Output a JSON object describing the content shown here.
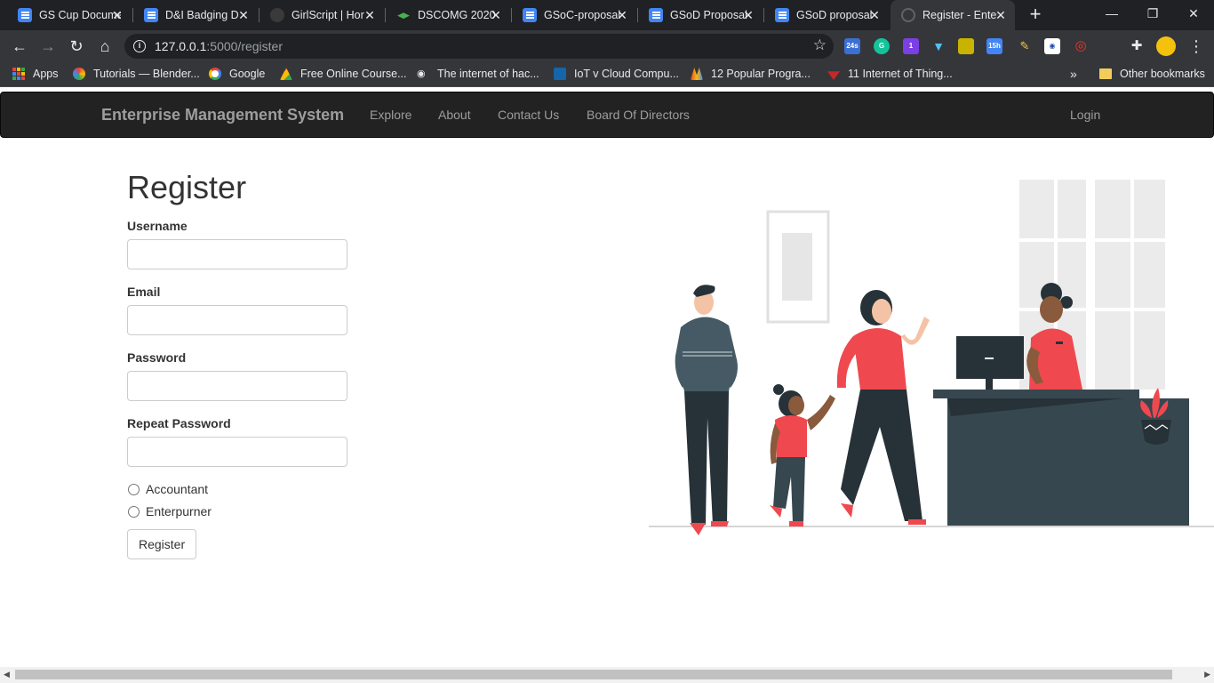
{
  "browser": {
    "tabs": [
      {
        "title": "GS Cup Documen",
        "icon": "docs-icon"
      },
      {
        "title": "D&I Badging D",
        "icon": "docs-icon"
      },
      {
        "title": "GirlScript | Hor",
        "icon": "girlscript-icon"
      },
      {
        "title": "DSCOMG 2020",
        "icon": "dsc-icon"
      },
      {
        "title": "GSoC-proposal",
        "icon": "docs-icon"
      },
      {
        "title": "GSoD Proposal",
        "icon": "docs-icon"
      },
      {
        "title": "GSoD proposal",
        "icon": "docs-icon"
      },
      {
        "title": "Register - Ente",
        "icon": "globe-icon",
        "active": true
      }
    ],
    "url_host": "127.0.0.1",
    "url_path": ":5000/register",
    "bookmarks": [
      "Apps",
      "Tutorials — Blender...",
      "Google",
      "Free Online Course...",
      "The internet of hac...",
      "IoT v Cloud Compu...",
      "12 Popular Progra...",
      "11 Internet of Thing..."
    ],
    "bookmarks_more": "»",
    "other_bookmarks": "Other bookmarks",
    "extensions": {
      "badge_1": "24s",
      "badge_2": "1",
      "badge_3": "15h"
    }
  },
  "navbar": {
    "brand": "Enterprise Management System",
    "links": [
      "Explore",
      "About",
      "Contact Us",
      "Board Of Directors"
    ],
    "login": "Login"
  },
  "form": {
    "title": "Register",
    "fields": [
      {
        "label": "Username",
        "value": ""
      },
      {
        "label": "Email",
        "value": ""
      },
      {
        "label": "Password",
        "value": ""
      },
      {
        "label": "Repeat Password",
        "value": ""
      }
    ],
    "roles": [
      "Accountant",
      "Enterpurner"
    ],
    "submit": "Register"
  },
  "colors": {
    "navbar_bg": "#222222",
    "navbar_text": "#9d9d9d",
    "accent_red": "#f0484f",
    "teal_dark": "#37474f",
    "figure_dark": "#263238"
  }
}
